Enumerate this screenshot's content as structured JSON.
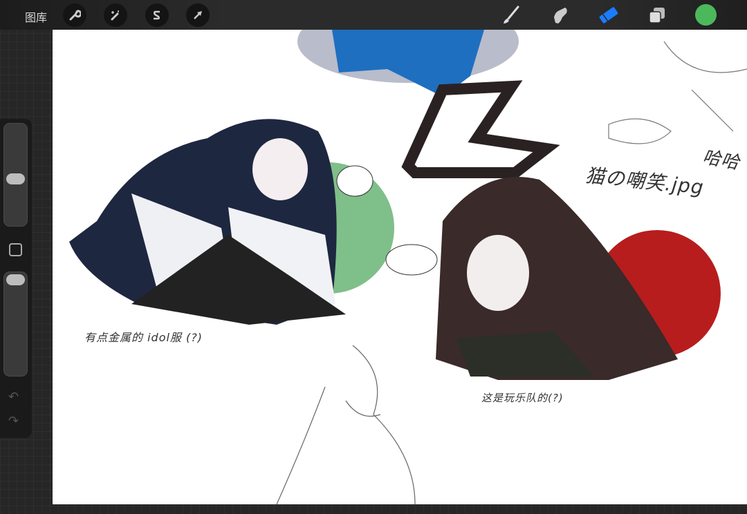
{
  "topbar": {
    "gallery_label": "图库",
    "left_tools": [
      {
        "icon": "wrench-icon",
        "name": "actions"
      },
      {
        "icon": "magic-wand-icon",
        "name": "adjustments"
      },
      {
        "icon": "selection-s-icon",
        "name": "selection"
      },
      {
        "icon": "arrow-cursor-icon",
        "name": "transform"
      }
    ],
    "right_tools": [
      {
        "icon": "brush-icon",
        "name": "paint"
      },
      {
        "icon": "smudge-icon",
        "name": "smudge"
      },
      {
        "icon": "eraser-icon",
        "name": "erase",
        "active": true
      },
      {
        "icon": "layers-icon",
        "name": "layers"
      }
    ],
    "active_color": "#4cb85c",
    "accent": "#1a7cff"
  },
  "sidebar": {
    "brush_size": 0.47,
    "opacity": 0.95,
    "modify_icon": "square-icon",
    "undo_icon": "undo-icon",
    "redo_icon": "redo-icon"
  },
  "canvas": {
    "notes": [
      "有点金属的 idol服 (?)",
      "这是玩乐队的(?)",
      "猫の嘲笑.jpg",
      "哈哈"
    ]
  }
}
